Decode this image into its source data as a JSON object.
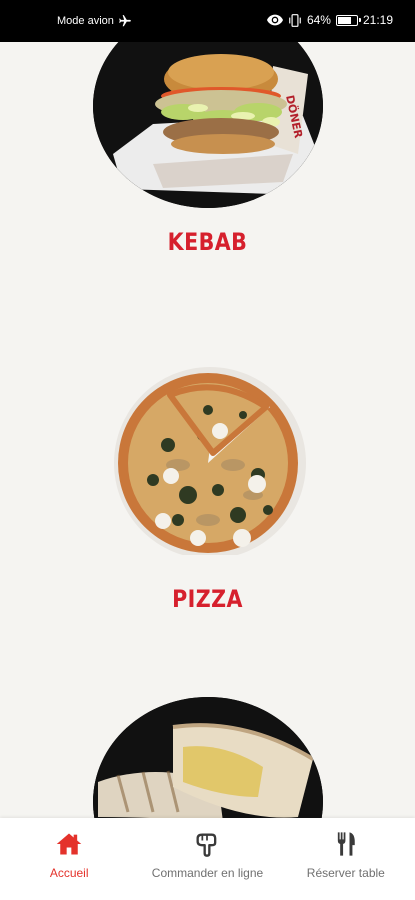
{
  "status_bar": {
    "mode": "Mode avion",
    "battery_text": "64%",
    "battery_level": 0.64,
    "time": "21:19"
  },
  "categories": [
    {
      "id": "kebab",
      "label": "KEBAB",
      "icon": "kebab-photo"
    },
    {
      "id": "pizza",
      "label": "PIZZA",
      "icon": "pizza-photo"
    },
    {
      "id": "tacos",
      "label": "",
      "icon": "tacos-photo"
    }
  ],
  "bottom_nav": {
    "items": [
      {
        "label": "Accueil",
        "icon": "home-icon",
        "active": true
      },
      {
        "label": "Commander en ligne",
        "icon": "hand-pointer-icon",
        "active": false
      },
      {
        "label": "Réserver table",
        "icon": "utensils-icon",
        "active": false
      }
    ]
  },
  "colors": {
    "accent": "#e4322b",
    "label_red": "#d6202d",
    "background": "#f5f4f1",
    "nav_inactive": "#707070"
  }
}
